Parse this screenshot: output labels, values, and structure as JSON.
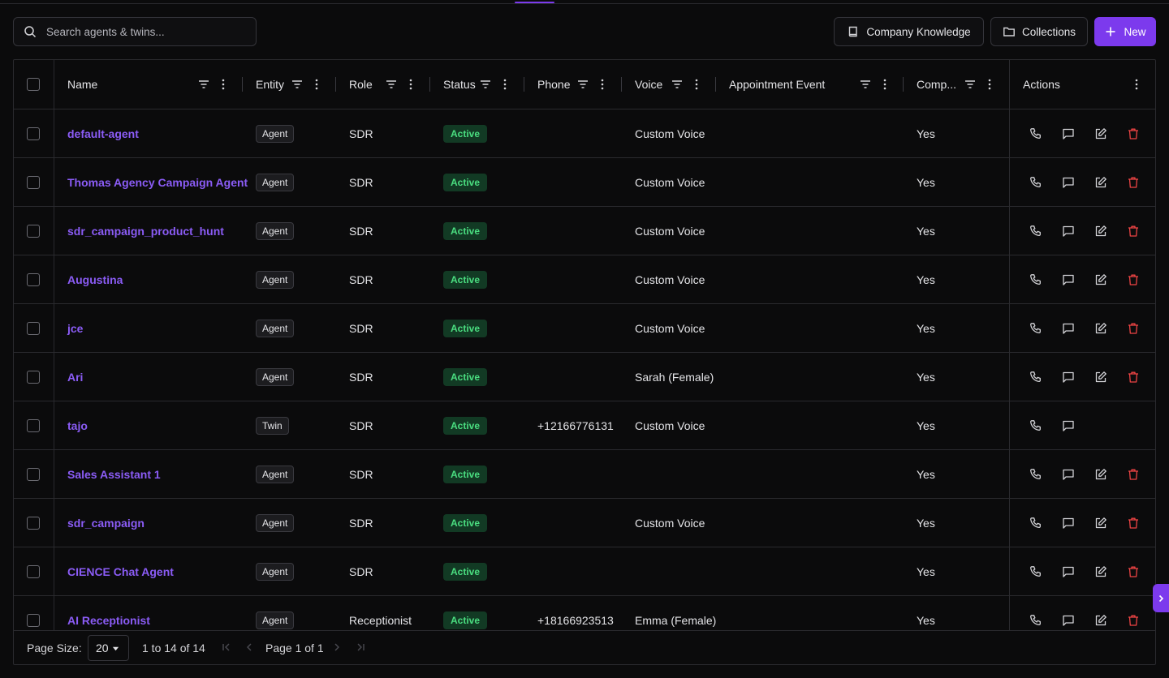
{
  "search": {
    "placeholder": "Search agents & twins..."
  },
  "toolbar": {
    "company_knowledge_label": "Company Knowledge",
    "collections_label": "Collections",
    "new_label": "New"
  },
  "columns": {
    "name": "Name",
    "entity": "Entity",
    "role": "Role",
    "status": "Status",
    "phone": "Phone",
    "voice": "Voice",
    "appointment_event": "Appointment Event",
    "comp": "Comp...",
    "actions": "Actions"
  },
  "rows": [
    {
      "name": "default-agent",
      "entity": "Agent",
      "role": "SDR",
      "status": "Active",
      "phone": "",
      "voice": "Custom Voice",
      "appointment_event": "",
      "comp": "Yes",
      "actions": [
        "call-icon",
        "chat-icon",
        "edit-icon",
        "trash-icon"
      ]
    },
    {
      "name": "Thomas Agency Campaign Agent",
      "entity": "Agent",
      "role": "SDR",
      "status": "Active",
      "phone": "",
      "voice": "Custom Voice",
      "appointment_event": "",
      "comp": "Yes",
      "actions": [
        "call-icon",
        "chat-icon",
        "edit-icon",
        "trash-icon"
      ]
    },
    {
      "name": "sdr_campaign_product_hunt",
      "entity": "Agent",
      "role": "SDR",
      "status": "Active",
      "phone": "",
      "voice": "Custom Voice",
      "appointment_event": "",
      "comp": "Yes",
      "actions": [
        "call-icon",
        "chat-icon",
        "edit-icon",
        "trash-icon"
      ]
    },
    {
      "name": "Augustina",
      "entity": "Agent",
      "role": "SDR",
      "status": "Active",
      "phone": "",
      "voice": "Custom Voice",
      "appointment_event": "",
      "comp": "Yes",
      "actions": [
        "call-icon",
        "chat-icon",
        "edit-icon",
        "trash-icon"
      ]
    },
    {
      "name": "jce",
      "entity": "Agent",
      "role": "SDR",
      "status": "Active",
      "phone": "",
      "voice": "Custom Voice",
      "appointment_event": "",
      "comp": "Yes",
      "actions": [
        "call-icon",
        "chat-icon",
        "edit-icon",
        "trash-icon"
      ]
    },
    {
      "name": "Ari",
      "entity": "Agent",
      "role": "SDR",
      "status": "Active",
      "phone": "",
      "voice": "Sarah (Female)",
      "appointment_event": "",
      "comp": "Yes",
      "actions": [
        "call-icon",
        "chat-icon",
        "edit-icon",
        "trash-icon"
      ]
    },
    {
      "name": "tajo",
      "entity": "Twin",
      "role": "SDR",
      "status": "Active",
      "phone": "+12166776131",
      "voice": "Custom Voice",
      "appointment_event": "",
      "comp": "Yes",
      "actions": [
        "call-icon",
        "chat-icon"
      ]
    },
    {
      "name": "Sales Assistant 1",
      "entity": "Agent",
      "role": "SDR",
      "status": "Active",
      "phone": "",
      "voice": "",
      "appointment_event": "",
      "comp": "Yes",
      "actions": [
        "call-icon",
        "chat-icon",
        "edit-icon",
        "trash-icon"
      ]
    },
    {
      "name": "sdr_campaign",
      "entity": "Agent",
      "role": "SDR",
      "status": "Active",
      "phone": "",
      "voice": "Custom Voice",
      "appointment_event": "",
      "comp": "Yes",
      "actions": [
        "call-icon",
        "chat-icon",
        "edit-icon",
        "trash-icon"
      ]
    },
    {
      "name": "CIENCE Chat Agent",
      "entity": "Agent",
      "role": "SDR",
      "status": "Active",
      "phone": "",
      "voice": "",
      "appointment_event": "",
      "comp": "Yes",
      "actions": [
        "call-icon",
        "chat-icon",
        "edit-icon",
        "trash-icon"
      ]
    },
    {
      "name": "AI Receptionist",
      "entity": "Agent",
      "role": "Receptionist",
      "status": "Active",
      "phone": "+18166923513",
      "voice": "Emma (Female)",
      "appointment_event": "",
      "comp": "Yes",
      "actions": [
        "call-icon",
        "chat-icon",
        "edit-icon",
        "trash-icon"
      ]
    }
  ],
  "pagination": {
    "page_size_label": "Page Size:",
    "page_size": "20",
    "range_text": "1 to 14 of 14",
    "page_text": "Page 1 of 1"
  },
  "colors": {
    "accent": "#7c3aed",
    "name_link": "#8b5cf6",
    "status_text": "#4ade80",
    "status_bg": "#123a24",
    "delete": "#ef4444"
  }
}
